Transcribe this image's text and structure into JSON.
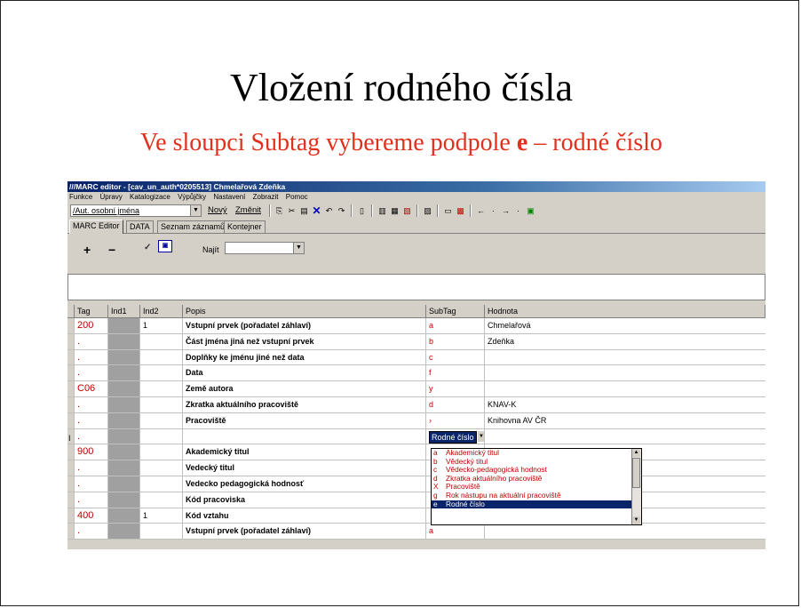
{
  "slide": {
    "title": "Vložení rodného čísla",
    "subtitle_pre": "Ve sloupci Subtag vybereme podpole ",
    "subtitle_bold": "e",
    "subtitle_post": " – rodné číslo"
  },
  "window": {
    "title": "///MARC editor - [cav_un_auth*0205513] Chmelařová Zdeňka"
  },
  "menu": [
    "Funkce",
    "Úpravy",
    "Katalogizace",
    "Výpůjčky",
    "Nastavení",
    "Zobrazit",
    "Pomoc"
  ],
  "toolbar": {
    "type_value": "/Aut. osobní jména",
    "new_label": "Nový",
    "change_label": "Změnit"
  },
  "tabs": [
    "MARC Editor",
    "DATA",
    "Seznam záznamů",
    "Kontejner"
  ],
  "iconbar": {
    "add_symbol": "+",
    "remove_symbol": "−",
    "find_label": "Najít"
  },
  "grid": {
    "headers": {
      "tag": "Tag",
      "ind1": "Ind1",
      "ind2": "Ind2",
      "popis": "Popis",
      "subtag": "SubTag",
      "hodnota": "Hodnota"
    },
    "rows": [
      {
        "tag": "200",
        "ind2": "1",
        "popis": "Vstupní prvek (pořadatel záhlaví)",
        "subtag": "a",
        "value": "Chmelařová"
      },
      {
        "tag": ".",
        "ind2": "",
        "popis": "Část jména jiná než vstupní prvek",
        "subtag": "b",
        "value": "Zdeňka"
      },
      {
        "tag": ".",
        "ind2": "",
        "popis": "Doplňky ke jménu jiné než data",
        "subtag": "c",
        "value": ""
      },
      {
        "tag": ".",
        "ind2": "",
        "popis": "Data",
        "subtag": "f",
        "value": ""
      },
      {
        "tag": "C06",
        "ind2": "",
        "popis": "Země autora",
        "subtag": "y",
        "value": ""
      },
      {
        "tag": ".",
        "ind2": "",
        "popis": "Zkratka aktuálního pracoviště",
        "subtag": "d",
        "value": "KNAV-K"
      },
      {
        "tag": ".",
        "ind2": "",
        "popis": "Pracoviště",
        "subtag": "›",
        "value": "Knihovna AV ČR"
      },
      {
        "tag": ".",
        "ind2": "",
        "popis": "",
        "subtag": "Rodné číslo",
        "value": "",
        "editing": true
      },
      {
        "tag": "900",
        "ind2": "",
        "popis": "Akademický titul",
        "subtag": "",
        "value": ""
      },
      {
        "tag": ".",
        "ind2": "",
        "popis": "Vedecký titul",
        "subtag": "",
        "value": ""
      },
      {
        "tag": ".",
        "ind2": "",
        "popis": "Vedecko pedagogická hodnosť",
        "subtag": "",
        "value": ""
      },
      {
        "tag": ".",
        "ind2": "",
        "popis": "Kód pracoviska",
        "subtag": "",
        "value": ""
      },
      {
        "tag": "400",
        "ind2": "1",
        "popis": "Kód vztahu",
        "subtag": "",
        "value": ""
      },
      {
        "tag": ".",
        "ind2": "",
        "popis": "Vstupní prvek (pořadatel záhlaví)",
        "subtag": "a",
        "value": ""
      }
    ]
  },
  "dropdown": {
    "items": [
      {
        "key": "a",
        "label": "Akademický titul"
      },
      {
        "key": "b",
        "label": "Vědecký titul"
      },
      {
        "key": "c",
        "label": "Vědecko-pedagogická hodnost"
      },
      {
        "key": "d",
        "label": "Zkratka aktuálního pracoviště"
      },
      {
        "key": "X",
        "label": "Pracoviště"
      },
      {
        "key": "g",
        "label": "Rok nástupu na aktuální pracoviště"
      },
      {
        "key": "e",
        "label": "Rodné číslo",
        "selected": true
      }
    ]
  },
  "colors": {
    "title_bar": "#0a246a",
    "subtitle_red": "#e0311c",
    "tag_red": "#c00000"
  }
}
